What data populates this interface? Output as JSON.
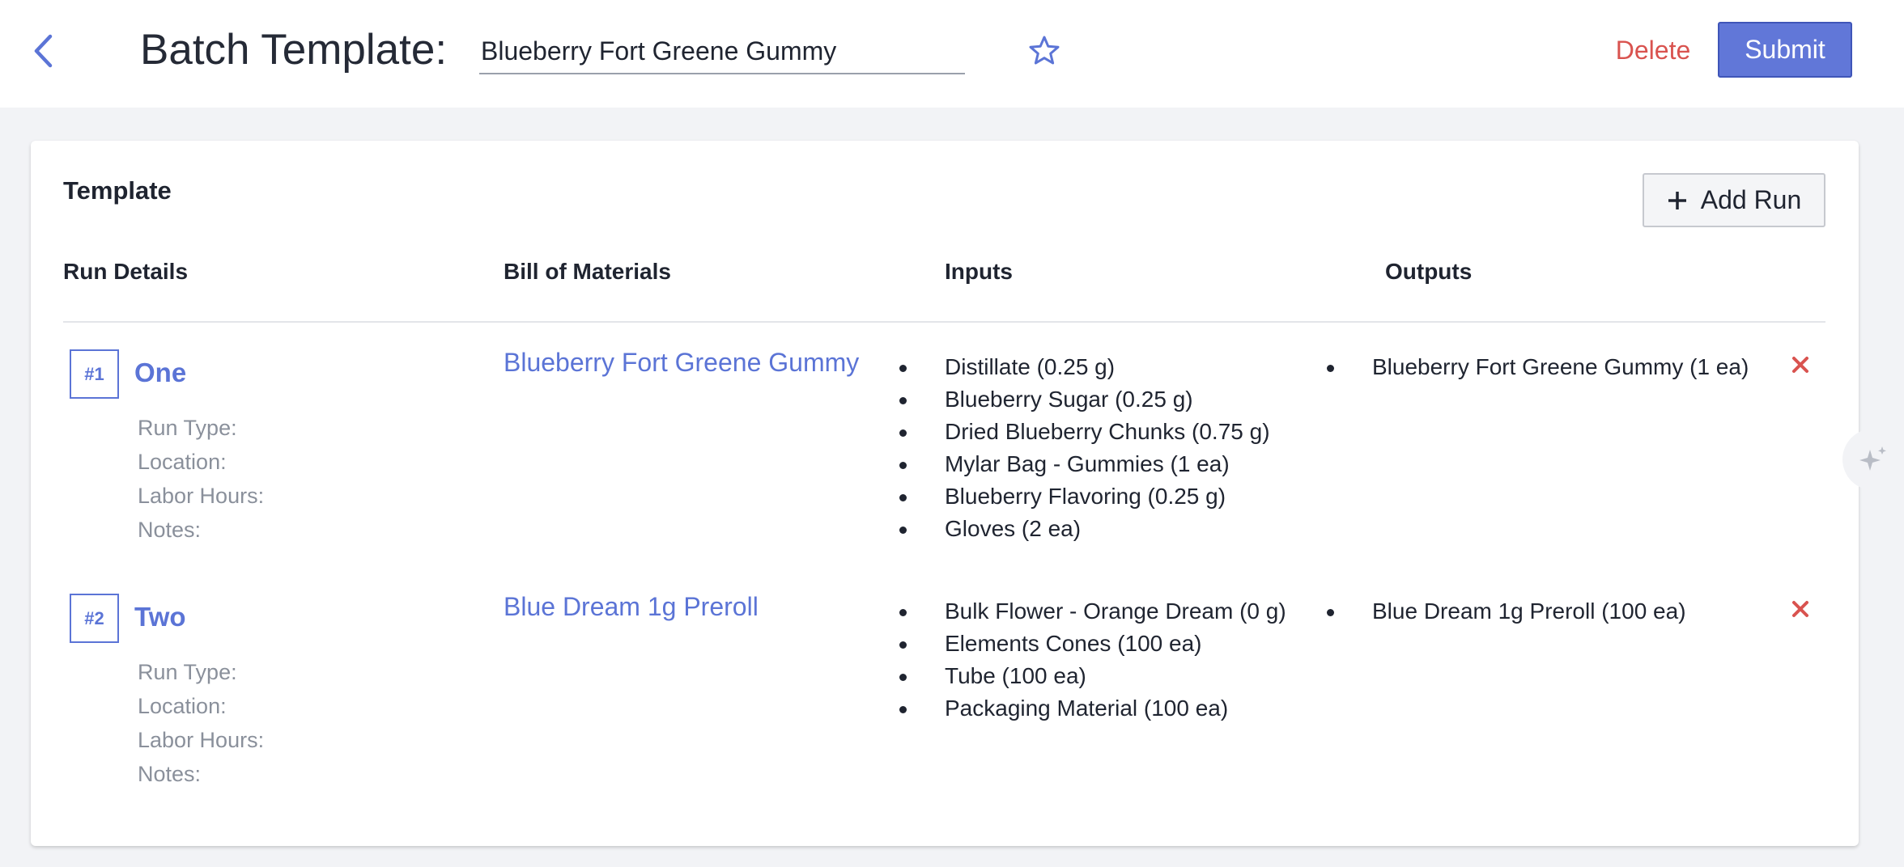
{
  "header": {
    "title": "Batch Template:",
    "template_name": "Blueberry Fort Greene Gummy",
    "delete_label": "Delete",
    "submit_label": "Submit"
  },
  "card": {
    "title": "Template",
    "add_run_label": "Add Run",
    "columns": [
      "Run Details",
      "Bill of Materials",
      "Inputs",
      "Outputs"
    ]
  },
  "detail_labels": [
    "Run Type:",
    "Location:",
    "Labor Hours:",
    "Notes:"
  ],
  "runs": [
    {
      "number": "#1",
      "name": "One",
      "bom": "Blueberry Fort Greene Gummy",
      "inputs": [
        "Distillate (0.25 g)",
        "Blueberry Sugar (0.25 g)",
        "Dried Blueberry Chunks (0.75 g)",
        "Mylar Bag - Gummies (1 ea)",
        "Blueberry Flavoring (0.25 g)",
        "Gloves (2 ea)"
      ],
      "outputs": [
        "Blueberry Fort Greene Gummy (1 ea)"
      ]
    },
    {
      "number": "#2",
      "name": "Two",
      "bom": "Blue Dream 1g Preroll",
      "inputs": [
        "Bulk Flower - Orange Dream (0 g)",
        "Elements Cones (100 ea)",
        "Tube (100 ea)",
        "Packaging Material (100 ea)"
      ],
      "outputs": [
        "Blue Dream 1g Preroll (100 ea)"
      ]
    }
  ],
  "colors": {
    "accent": "#5b74d6",
    "submit": "#6177d8",
    "danger": "#d9534f",
    "background": "#f2f3f6"
  },
  "icons": {
    "back": "chevron-left-icon",
    "favorite": "star-outline-icon",
    "add": "plus-icon",
    "remove": "close-x-icon",
    "assistant": "sparkle-icon"
  }
}
